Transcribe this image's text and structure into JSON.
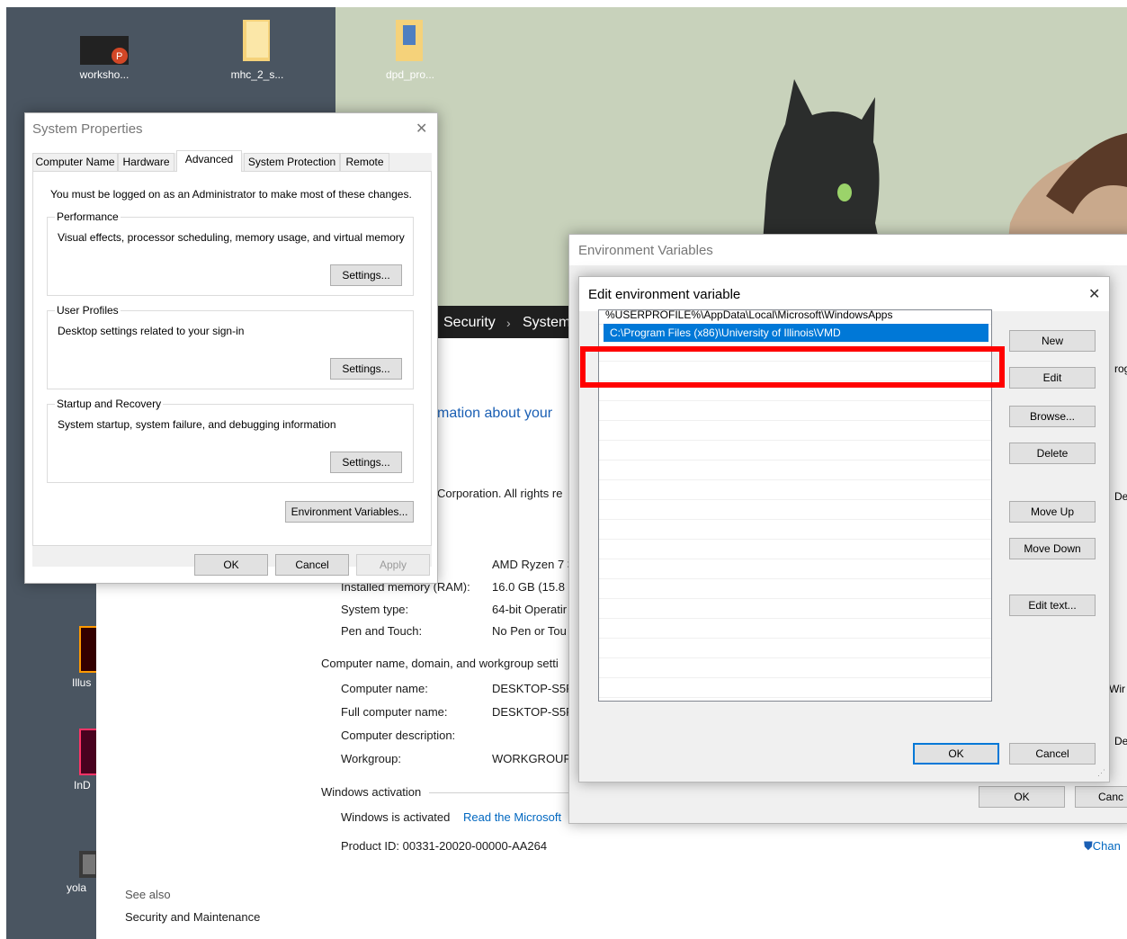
{
  "desktop": {
    "icons": [
      {
        "label": "worksho..."
      },
      {
        "label": "mhc_2_s..."
      },
      {
        "label": "dpd_pro..."
      },
      {
        "label": "Illus"
      },
      {
        "label": "InD"
      },
      {
        "label": "yola"
      }
    ]
  },
  "about_window": {
    "breadcrumb_1": "Security",
    "breadcrumb_sep": "›",
    "breadcrumb_2": "System",
    "heading_partial": "mation about your",
    "copyright_partial": "Corporation. All rights re",
    "specs": [
      {
        "label": "",
        "value": "AMD Ryzen 7 3"
      },
      {
        "label": "Installed memory (RAM):",
        "value": "16.0 GB (15.8 G"
      },
      {
        "label": "System type:",
        "value": "64-bit Operatir"
      },
      {
        "label": "Pen and Touch:",
        "value": "No Pen or Tou"
      }
    ],
    "computer_section": "Computer name, domain, and workgroup setti",
    "computer_rows": [
      {
        "label": "Computer name:",
        "value": "DESKTOP-S5PF"
      },
      {
        "label": "Full computer name:",
        "value": "DESKTOP-S5PF"
      },
      {
        "label": "Computer description:",
        "value": ""
      },
      {
        "label": "Workgroup:",
        "value": "WORKGROUP"
      }
    ],
    "activation_section": "Windows activation",
    "activation_status": "Windows is activated",
    "activation_link": "Read the Microsoft",
    "product_id": "Product ID: 00331-20020-00000-AA264",
    "change_link": "Chan",
    "see_also": "See also",
    "security_link": "Security and Maintenance"
  },
  "system_properties": {
    "title": "System Properties",
    "close": "✕",
    "tabs": [
      "Computer Name",
      "Hardware",
      "Advanced",
      "System Protection",
      "Remote"
    ],
    "admin_note": "You must be logged on as an Administrator to make most of these changes.",
    "performance": {
      "label": "Performance",
      "desc": "Visual effects, processor scheduling, memory usage, and virtual memory",
      "button": "Settings..."
    },
    "user_profiles": {
      "label": "User Profiles",
      "desc": "Desktop settings related to your sign-in",
      "button": "Settings..."
    },
    "startup": {
      "label": "Startup and Recovery",
      "desc": "System startup, system failure, and debugging information",
      "button": "Settings..."
    },
    "env_button": "Environment Variables...",
    "ok": "OK",
    "cancel": "Cancel",
    "apply": "Apply"
  },
  "environment_variables": {
    "title": "Environment Variables",
    "partial_right_1": "rog",
    "partial_right_2": "Dele",
    "partial_right_3": "Wir",
    "partial_right_4": "Dele",
    "ok": "OK",
    "cancel": "Canc"
  },
  "edit_env": {
    "title": "Edit environment variable",
    "close": "✕",
    "entries": [
      "%USERPROFILE%\\AppData\\Local\\Microsoft\\WindowsApps",
      "C:\\Program Files (x86)\\University of Illinois\\VMD"
    ],
    "buttons": {
      "new": "New",
      "edit": "Edit",
      "browse": "Browse...",
      "delete": "Delete",
      "move_up": "Move Up",
      "move_down": "Move Down",
      "edit_text": "Edit text..."
    },
    "ok": "OK",
    "cancel": "Cancel",
    "highlight_color": "#ff0000"
  }
}
